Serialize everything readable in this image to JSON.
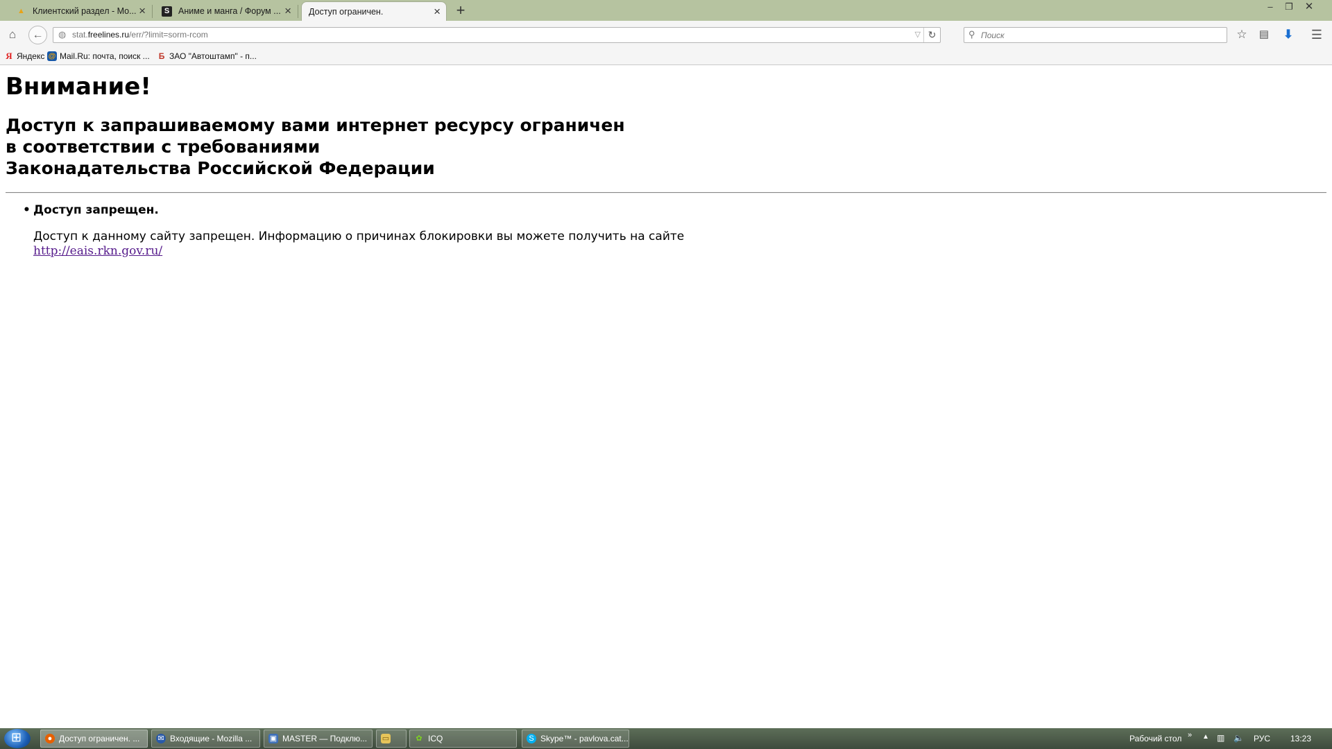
{
  "browser": {
    "tabs": [
      {
        "label": "Клиентский раздел - Мо...",
        "icon": "warning-icon"
      },
      {
        "label": "Аниме и манга / Форум ...",
        "icon": "s-logo-icon"
      },
      {
        "label": "Доступ ограничен.",
        "icon": "none",
        "active": true
      }
    ],
    "url": {
      "prefix": "stat.",
      "domain": "freelines.ru",
      "path": "/err/?limit=sorm-rcom"
    },
    "search": {
      "placeholder": "Поиск"
    },
    "bookmarks": [
      {
        "label": "Яндекс",
        "icon": "yandex-icon"
      },
      {
        "label": "Mail.Ru: почта, поиск ...",
        "icon": "mailru-icon"
      },
      {
        "label": "ЗАО \"Автоштамп\" - п...",
        "icon": "avtoshtamp-icon"
      }
    ]
  },
  "page": {
    "title": "Внимание!",
    "subtitle_lines": [
      "Доступ к запрашиваемому вами интернет ресурсу ограничен",
      "в соответствии с требованиями",
      "Законадательства Российской Федерации"
    ],
    "item_heading": "Доступ запрещен.",
    "item_text": "Доступ к данному сайту запрещен. Информацию о причинах блокировки вы можете получить на сайте",
    "item_link": "http://eais.rkn.gov.ru/"
  },
  "taskbar": {
    "tasks": [
      {
        "label": "Доступ ограничен. ..."
      },
      {
        "label": "Входящие - Mozilla ..."
      },
      {
        "label": "MASTER — Подклю..."
      },
      {
        "label": ""
      },
      {
        "label": "ICQ"
      },
      {
        "label": "Skype™ - pavlova.cat..."
      }
    ],
    "desktop_label": "Рабочий стол",
    "language": "РУС",
    "clock": "13:23"
  }
}
